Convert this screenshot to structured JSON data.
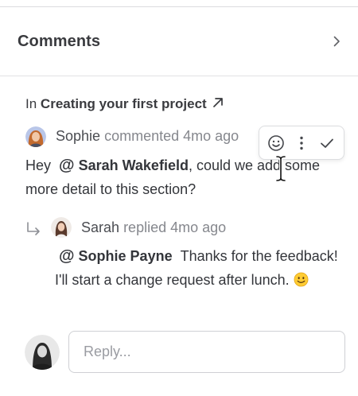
{
  "header": {
    "title": "Comments",
    "chevron_icon": "chevron-right-icon"
  },
  "context": {
    "prefix": "In",
    "project": "Creating your first project",
    "link_icon": "arrow-up-right-icon"
  },
  "comments": [
    {
      "author": "Sophie",
      "action": "commented",
      "time": "4mo ago",
      "avatar_icon": "avatar-sophie",
      "body": {
        "before": "Hey",
        "mention_at": "@",
        "mention": "Sarah Wakefield",
        "after": ", could we add some more detail to this section?"
      },
      "toolbar": {
        "emoji_icon": "smiley-icon",
        "more_icon": "more-vertical-icon",
        "resolve_icon": "check-icon"
      }
    },
    {
      "author": "Sarah",
      "action": "replied",
      "time": "4mo ago",
      "avatar_icon": "avatar-sarah",
      "reply_icon": "reply-arrow-icon",
      "body": {
        "mention_at": "@",
        "mention": "Sophie Payne",
        "after": "Thanks for the feedback! I'll start a change request after lunch.",
        "emoji": "slightly-smiling-face-emoji"
      }
    }
  ],
  "reply": {
    "placeholder": "Reply...",
    "avatar_icon": "avatar-current-user"
  },
  "colors": {
    "text": "#33353a",
    "muted": "#85878d",
    "border": "#dcdde0"
  }
}
